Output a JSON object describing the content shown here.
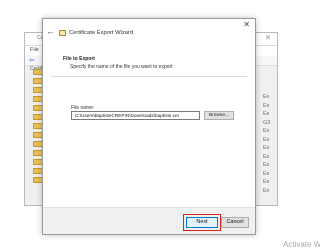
{
  "background_window": {
    "title": "Cer",
    "menu_file": "File",
    "column_header": "Certif",
    "right_column": [
      "Ex",
      "Ex",
      "Ex",
      "G3",
      "Ex",
      "Ex",
      "Ex",
      "Ex",
      "Ex",
      "Ex",
      "Ex",
      "Ex"
    ]
  },
  "wizard": {
    "title": "Certificate Export Wizard",
    "back_icon": "back-arrow-icon",
    "close_icon": "close-icon",
    "step_title": "File to Export",
    "step_description": "Specify the name of the file you want to export",
    "file_name_label": "File name:",
    "file_name_value": "C:\\Users\\BaptisteCREPIN\\Downloads\\baptiste.cer",
    "browse_label": "Browse...",
    "next_label": "Next",
    "cancel_label": "Cancel"
  },
  "colors": {
    "highlight": "#d42424",
    "primary_button_border": "#0078d7"
  },
  "watermark": "Activate W"
}
